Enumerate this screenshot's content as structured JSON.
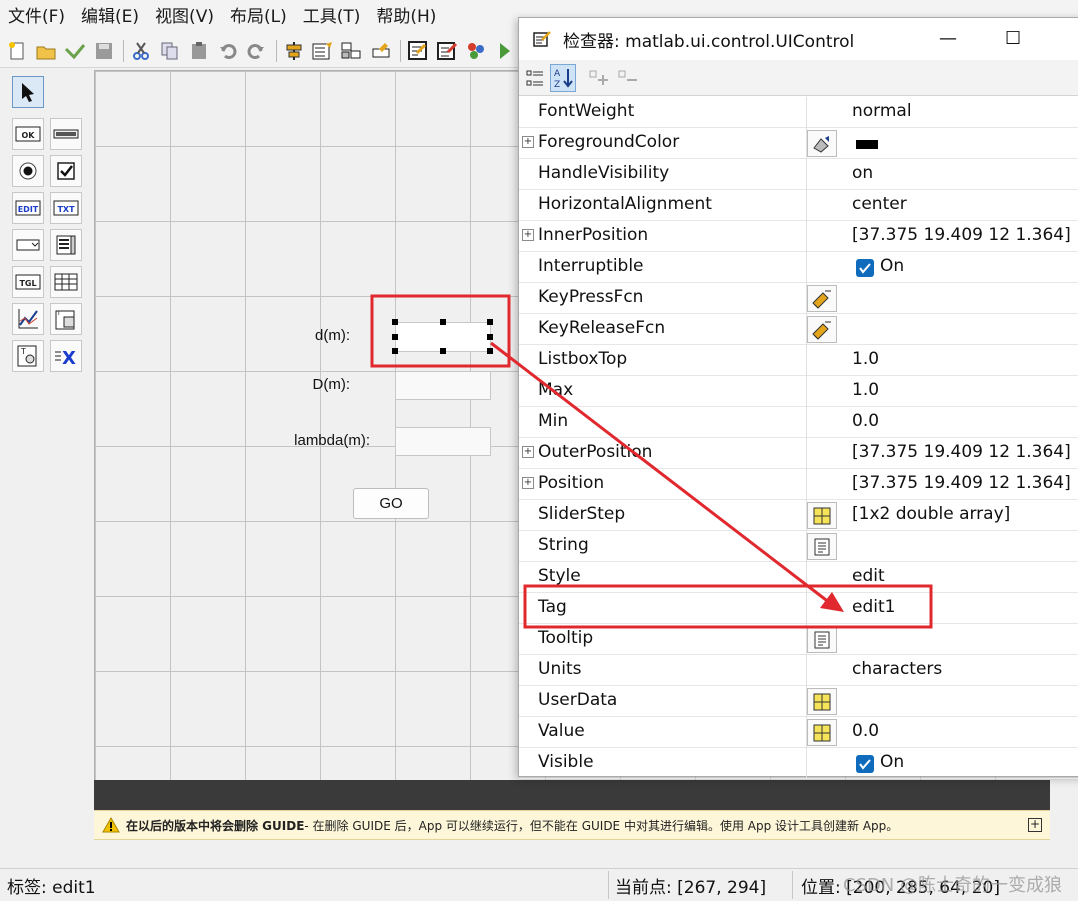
{
  "menu": [
    "文件(F)",
    "编辑(E)",
    "视图(V)",
    "布局(L)",
    "工具(T)",
    "帮助(H)"
  ],
  "toolbar_icons": [
    "new-file-icon",
    "open-folder-icon",
    "save-icon",
    "cut-icon",
    "copy-icon",
    "paste-icon",
    "undo-icon",
    "redo-icon",
    "align-icon",
    "menu-editor-icon",
    "tab-order-icon",
    "toolbar-editor-icon",
    "editor-icon",
    "property-inspector-icon",
    "object-browser-icon",
    "run-icon"
  ],
  "palette": [
    {
      "icon": "select-arrow-icon",
      "text": ""
    },
    {
      "icon": "push-button-icon",
      "text": "OK"
    },
    {
      "icon": "slider-icon",
      "text": ""
    },
    {
      "icon": "radio-button-icon",
      "text": ""
    },
    {
      "icon": "checkbox-icon",
      "text": ""
    },
    {
      "icon": "edit-text-icon",
      "text": "EDIT"
    },
    {
      "icon": "static-text-icon",
      "text": "TXT"
    },
    {
      "icon": "popup-menu-icon",
      "text": ""
    },
    {
      "icon": "listbox-icon",
      "text": ""
    },
    {
      "icon": "toggle-button-icon",
      "text": "TGL"
    },
    {
      "icon": "table-icon",
      "text": ""
    },
    {
      "icon": "axes-icon",
      "text": ""
    },
    {
      "icon": "panel-icon",
      "text": ""
    },
    {
      "icon": "button-group-icon",
      "text": ""
    },
    {
      "icon": "activex-icon",
      "text": "X"
    }
  ],
  "figure": {
    "label_d": "d(m):",
    "label_D": "D(m):",
    "label_lambda": "lambda(m):",
    "go_button": "GO"
  },
  "warning": {
    "bold": "在以后的版本中将会删除 GUIDE",
    "rest": " - 在删除 GUIDE 后，App 可以继续运行，但不能在 GUIDE 中对其进行编辑。使用 App 设计工具创建新 App。",
    "expand": "+"
  },
  "status": {
    "tag": "标签: edit1",
    "current_point": "当前点:  [267, 294]",
    "position": "位置: [200, 285, 64, 20]",
    "watermark": "CSDN @陈士奇的一变成狼"
  },
  "inspector": {
    "title": "检查器:  matlab.ui.control.UIControl",
    "minimize": "—",
    "maximize": "☐",
    "rows": [
      {
        "name": "FontWeight",
        "value": "normal",
        "expand": false,
        "button": "",
        "check": false,
        "swatch": false
      },
      {
        "name": "ForegroundColor",
        "value": "",
        "expand": true,
        "button": "color-picker-icon",
        "check": false,
        "swatch": true
      },
      {
        "name": "HandleVisibility",
        "value": "on",
        "expand": false,
        "button": "",
        "check": false,
        "swatch": false
      },
      {
        "name": "HorizontalAlignment",
        "value": "center",
        "expand": false,
        "button": "",
        "check": false,
        "swatch": false
      },
      {
        "name": "InnerPosition",
        "value": "[37.375 19.409 12 1.364]",
        "expand": true,
        "button": "",
        "check": false,
        "swatch": false
      },
      {
        "name": "Interruptible",
        "value": "On",
        "expand": false,
        "button": "",
        "check": true,
        "swatch": false
      },
      {
        "name": "KeyPressFcn",
        "value": "",
        "expand": false,
        "button": "callback-pencil-icon",
        "check": false,
        "swatch": false
      },
      {
        "name": "KeyReleaseFcn",
        "value": "",
        "expand": false,
        "button": "callback-pencil-icon",
        "check": false,
        "swatch": false
      },
      {
        "name": "ListboxTop",
        "value": "1.0",
        "expand": false,
        "button": "",
        "check": false,
        "swatch": false
      },
      {
        "name": "Max",
        "value": "1.0",
        "expand": false,
        "button": "",
        "check": false,
        "swatch": false
      },
      {
        "name": "Min",
        "value": "0.0",
        "expand": false,
        "button": "",
        "check": false,
        "swatch": false
      },
      {
        "name": "OuterPosition",
        "value": "[37.375 19.409 12 1.364]",
        "expand": true,
        "button": "",
        "check": false,
        "swatch": false
      },
      {
        "name": "Position",
        "value": "[37.375 19.409 12 1.364]",
        "expand": true,
        "button": "",
        "check": false,
        "swatch": false
      },
      {
        "name": "SliderStep",
        "value": "[1x2  double array]",
        "expand": false,
        "button": "array-editor-icon",
        "check": false,
        "swatch": false
      },
      {
        "name": "String",
        "value": "",
        "expand": false,
        "button": "text-editor-icon",
        "check": false,
        "swatch": false
      },
      {
        "name": "Style",
        "value": "edit",
        "expand": false,
        "button": "",
        "check": false,
        "swatch": false
      },
      {
        "name": "Tag",
        "value": "edit1",
        "expand": false,
        "button": "",
        "check": false,
        "swatch": false
      },
      {
        "name": "Tooltip",
        "value": "",
        "expand": false,
        "button": "text-editor-icon",
        "check": false,
        "swatch": false
      },
      {
        "name": "Units",
        "value": "characters",
        "expand": false,
        "button": "",
        "check": false,
        "swatch": false
      },
      {
        "name": "UserData",
        "value": "",
        "expand": false,
        "button": "array-editor-icon",
        "check": false,
        "swatch": false
      },
      {
        "name": "Value",
        "value": "0.0",
        "expand": false,
        "button": "array-editor-icon",
        "check": false,
        "swatch": false
      },
      {
        "name": "Visible",
        "value": "On",
        "expand": false,
        "button": "",
        "check": true,
        "swatch": false
      }
    ]
  },
  "colors": {
    "annotation_red": "#e0282e",
    "check_blue": "#0f6cbd",
    "warning_bg": "#fdf6d8"
  }
}
